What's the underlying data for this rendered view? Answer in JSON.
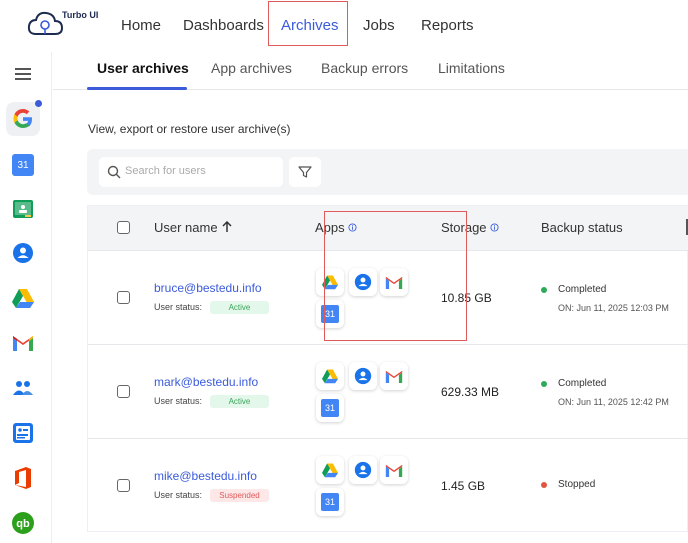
{
  "brand": {
    "name": "Turbo UI"
  },
  "nav": [
    {
      "label": "Home"
    },
    {
      "label": "Dashboards"
    },
    {
      "label": "Archives"
    },
    {
      "label": "Jobs"
    },
    {
      "label": "Reports"
    }
  ],
  "nav_active": "Archives",
  "sidebar": {
    "items": [
      {
        "icon": "google-icon"
      },
      {
        "icon": "calendar-icon",
        "text": "31"
      },
      {
        "icon": "classroom-icon"
      },
      {
        "icon": "contacts-icon"
      },
      {
        "icon": "drive-icon"
      },
      {
        "icon": "gmail-icon"
      },
      {
        "icon": "groups-icon"
      },
      {
        "icon": "directory-icon"
      },
      {
        "icon": "office-icon"
      },
      {
        "icon": "quickbooks-icon"
      }
    ]
  },
  "tabs": [
    {
      "label": "User archives"
    },
    {
      "label": "App archives"
    },
    {
      "label": "Backup errors"
    },
    {
      "label": "Limitations"
    }
  ],
  "description": "View, export or restore user archive(s)",
  "search": {
    "placeholder": "Search for users"
  },
  "table": {
    "headers": {
      "username": "User name",
      "apps": "Apps",
      "storage": "Storage",
      "status": "Backup status"
    },
    "rows": [
      {
        "email": "bruce@bestedu.info",
        "status_label": "User status:",
        "status": "Active",
        "storage": "10.85 GB",
        "backup": "Completed",
        "date": "ON:  Jun 11, 2025 12:03 PM"
      },
      {
        "email": "mark@bestedu.info",
        "status_label": "User status:",
        "status": "Active",
        "storage": "629.33 MB",
        "backup": "Completed",
        "date": "ON:  Jun 11, 2025 12:42 PM"
      },
      {
        "email": "mike@bestedu.info",
        "status_label": "User status:",
        "status": "Suspended",
        "storage": "1.45 GB",
        "backup": "Stopped",
        "date": ""
      }
    ]
  },
  "colors": {
    "accent": "#3b5bdb",
    "completed": "#2eaa5a",
    "stopped": "#e0553f",
    "highlight": "#e05a5a"
  }
}
